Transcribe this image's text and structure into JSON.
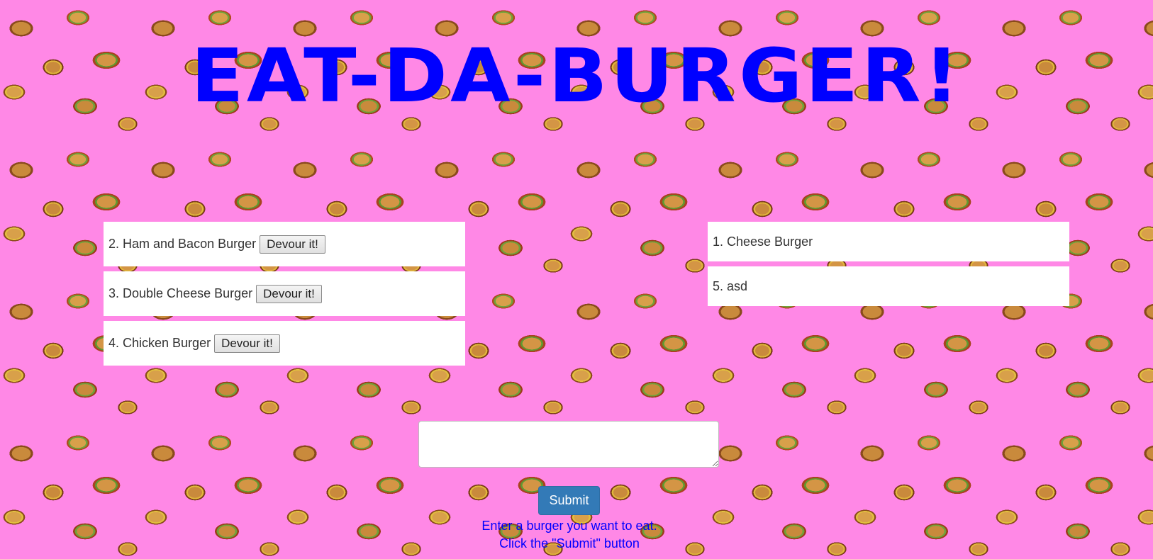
{
  "header": {
    "title": "EAT-DA-BURGER!"
  },
  "uneaten_burgers": [
    {
      "label": "2. Ham and Bacon Burger",
      "button_label": "Devour it!"
    },
    {
      "label": "3. Double Cheese Burger",
      "button_label": "Devour it!"
    },
    {
      "label": "4. Chicken Burger",
      "button_label": "Devour it!"
    }
  ],
  "devoured_burgers": [
    {
      "label": "1. Cheese Burger"
    },
    {
      "label": "5. asd"
    }
  ],
  "form": {
    "input_value": "",
    "submit_label": "Submit",
    "instructions": [
      "Enter a burger you want to eat.",
      "Click the \"Submit\" button"
    ]
  },
  "colors": {
    "background": "#ff88e6",
    "title": "#0000ff",
    "submit_button": "#337ab7",
    "instructions_text": "#0000ff"
  }
}
